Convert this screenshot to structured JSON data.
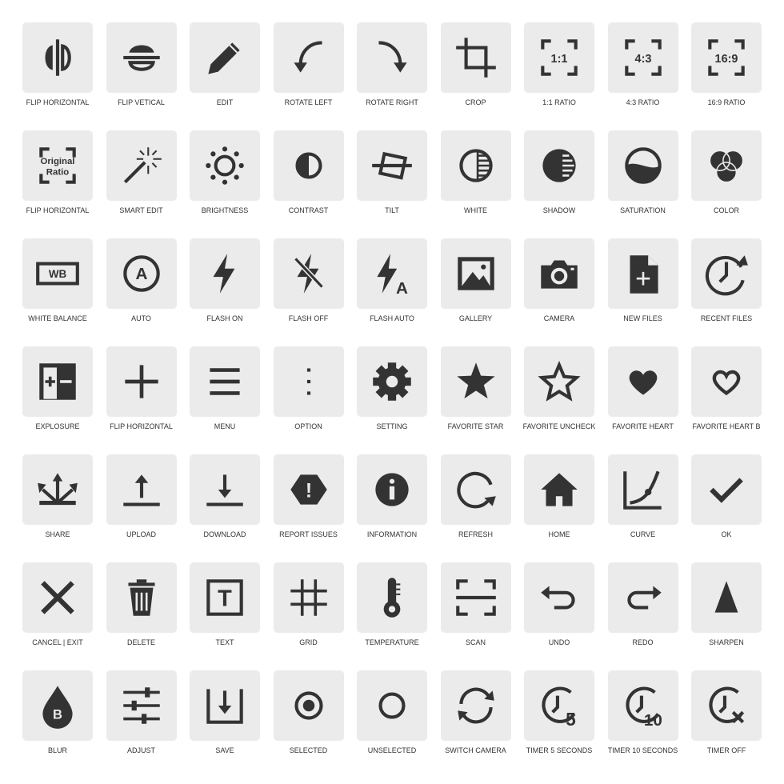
{
  "colors": {
    "tile": "#ebebeb",
    "icon": "#333333",
    "label": "#333333"
  },
  "icons": [
    {
      "label": "FLIP HORIZONTAL",
      "icon": "flip-horizontal"
    },
    {
      "label": "FLIP VETICAL",
      "icon": "flip-vertical"
    },
    {
      "label": "EDIT",
      "icon": "pencil"
    },
    {
      "label": "ROTATE LEFT",
      "icon": "rotate-left"
    },
    {
      "label": "ROTATE RIGHT",
      "icon": "rotate-right"
    },
    {
      "label": "CROP",
      "icon": "crop"
    },
    {
      "label": "1:1 RATIO",
      "icon": "ratio",
      "text": "1:1"
    },
    {
      "label": "4:3 RATIO",
      "icon": "ratio",
      "text": "4:3"
    },
    {
      "label": "16:9 RATIO",
      "icon": "ratio",
      "text": "16:9"
    },
    {
      "label": "FLIP HORIZONTAL",
      "icon": "ratio-original",
      "text": "Original",
      "text2": "Ratio"
    },
    {
      "label": "SMART EDIT",
      "icon": "magic-wand"
    },
    {
      "label": "BRIGHTNESS",
      "icon": "sun"
    },
    {
      "label": "CONTRAST",
      "icon": "contrast"
    },
    {
      "label": "TILT",
      "icon": "tilt"
    },
    {
      "label": "WHITE",
      "icon": "white"
    },
    {
      "label": "SHADOW",
      "icon": "shadow"
    },
    {
      "label": "SATURATION",
      "icon": "saturation"
    },
    {
      "label": "COLOR",
      "icon": "color"
    },
    {
      "label": "WHITE BALANCE",
      "icon": "white-balance",
      "text": "WB"
    },
    {
      "label": "AUTO",
      "icon": "auto",
      "text": "A"
    },
    {
      "label": "FLASH ON",
      "icon": "flash-on"
    },
    {
      "label": "FLASH OFF",
      "icon": "flash-off"
    },
    {
      "label": "FLASH AUTO",
      "icon": "flash-auto",
      "text": "A"
    },
    {
      "label": "GALLERY",
      "icon": "image"
    },
    {
      "label": "CAMERA",
      "icon": "camera"
    },
    {
      "label": "NEW FILES",
      "icon": "new-file"
    },
    {
      "label": "RECENT FILES",
      "icon": "history"
    },
    {
      "label": "EXPLOSURE",
      "icon": "exposure"
    },
    {
      "label": "FLIP HORIZONTAL",
      "icon": "plus"
    },
    {
      "label": "MENU",
      "icon": "menu"
    },
    {
      "label": "OPTION",
      "icon": "dots-vertical"
    },
    {
      "label": "SETTING",
      "icon": "gear"
    },
    {
      "label": "FAVORITE STAR",
      "icon": "star"
    },
    {
      "label": "FAVORITE UNCHECK",
      "icon": "star-outline"
    },
    {
      "label": "FAVORITE HEART",
      "icon": "heart"
    },
    {
      "label": "FAVORITE HEART B",
      "icon": "heart-outline"
    },
    {
      "label": "SHARE",
      "icon": "share"
    },
    {
      "label": "UPLOAD",
      "icon": "upload"
    },
    {
      "label": "DOWNLOAD",
      "icon": "download"
    },
    {
      "label": "REPORT ISSUES",
      "icon": "report",
      "text": "!"
    },
    {
      "label": "INFORMATION",
      "icon": "info"
    },
    {
      "label": "REFRESH",
      "icon": "refresh"
    },
    {
      "label": "HOME",
      "icon": "home"
    },
    {
      "label": "CURVE",
      "icon": "curve"
    },
    {
      "label": "OK",
      "icon": "check"
    },
    {
      "label": "CANCEL | EXIT",
      "icon": "close"
    },
    {
      "label": "DELETE",
      "icon": "trash"
    },
    {
      "label": "TEXT",
      "icon": "text-box",
      "text": "T"
    },
    {
      "label": "GRID",
      "icon": "grid"
    },
    {
      "label": "TEMPERATURE",
      "icon": "thermometer"
    },
    {
      "label": "SCAN",
      "icon": "scan"
    },
    {
      "label": "UNDO",
      "icon": "undo"
    },
    {
      "label": "REDO",
      "icon": "redo"
    },
    {
      "label": "SHARPEN",
      "icon": "triangle"
    },
    {
      "label": "BLUR",
      "icon": "drop",
      "text": "B"
    },
    {
      "label": "ADJUST",
      "icon": "sliders"
    },
    {
      "label": "SAVE",
      "icon": "save"
    },
    {
      "label": "SELECTED",
      "icon": "radio-selected"
    },
    {
      "label": "UNSELECTED",
      "icon": "radio-unselected"
    },
    {
      "label": "SWITCH CAMERA",
      "icon": "switch-camera"
    },
    {
      "label": "TIMER 5 SECONDS",
      "icon": "timer",
      "text": "5"
    },
    {
      "label": "TIMER 10 SECONDS",
      "icon": "timer",
      "text": "10"
    },
    {
      "label": "TIMER OFF",
      "icon": "timer-off"
    }
  ]
}
